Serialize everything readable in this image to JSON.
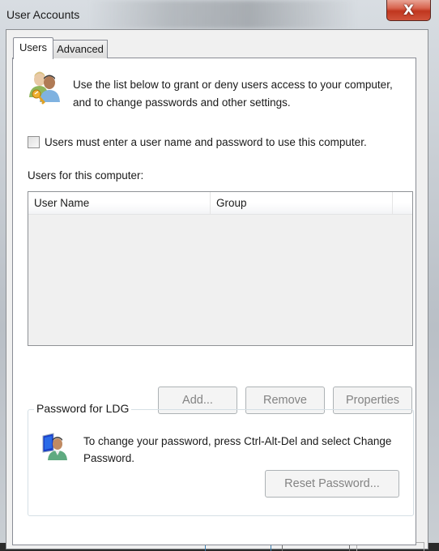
{
  "window": {
    "title": "User Accounts",
    "close_symbol": "X"
  },
  "tabs": [
    {
      "label": "Users",
      "selected": true
    },
    {
      "label": "Advanced",
      "selected": false
    }
  ],
  "intro": {
    "icon": "users-key-icon",
    "text": "Use the list below to grant or deny users access to your computer, and to change passwords and other settings."
  },
  "require_login": {
    "label": "Users must enter a user name and password to use this computer.",
    "checked": false
  },
  "users_list": {
    "label": "Users for this computer:",
    "columns": [
      "User Name",
      "Group"
    ],
    "rows": []
  },
  "list_buttons": {
    "add": "Add...",
    "remove": "Remove",
    "properties": "Properties"
  },
  "password_group": {
    "title": "Password for LDG",
    "icon": "user-monitor-icon",
    "text": "To change your password, press Ctrl-Alt-Del and select Change Password.",
    "reset_button": "Reset Password..."
  }
}
